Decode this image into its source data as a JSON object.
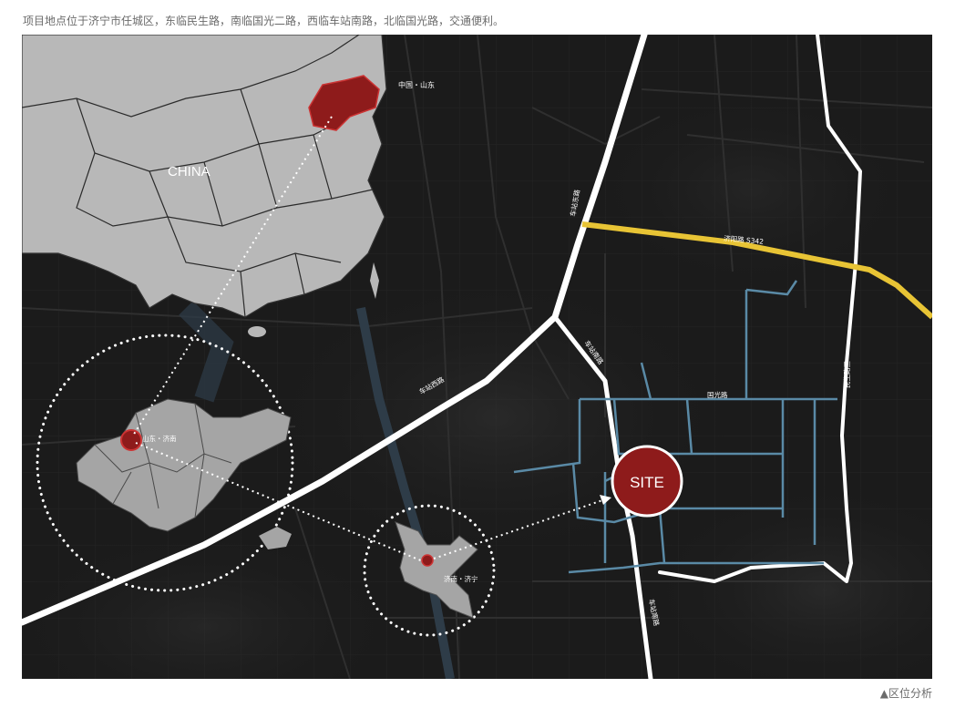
{
  "header": {
    "description": "项目地点位于济宁市任城区，东临民生路，南临国光二路，西临车站南路，北临国光路，交通便利。"
  },
  "footer": {
    "figure_caption": "▲区位分析"
  },
  "map": {
    "country_label": "CHINA",
    "province_label": "中国・山东",
    "city_label": "山东・济南",
    "district_label": "济南・济宁",
    "site_label": "SITE",
    "roads": {
      "north_road": "车站东路",
      "highway": "济阳路 S342",
      "station_north": "车站南路",
      "west_road": "车站西路",
      "guoguang": "国光路",
      "east_road": "民生路三",
      "station_south": "车站南路"
    },
    "colors": {
      "background": "#1b1b1b",
      "land": "#b8b8b8",
      "highlight": "#8e1b1b",
      "highway": "#e8c435",
      "local_roads": "#5a8aa6",
      "main_roads": "#ffffff"
    }
  }
}
